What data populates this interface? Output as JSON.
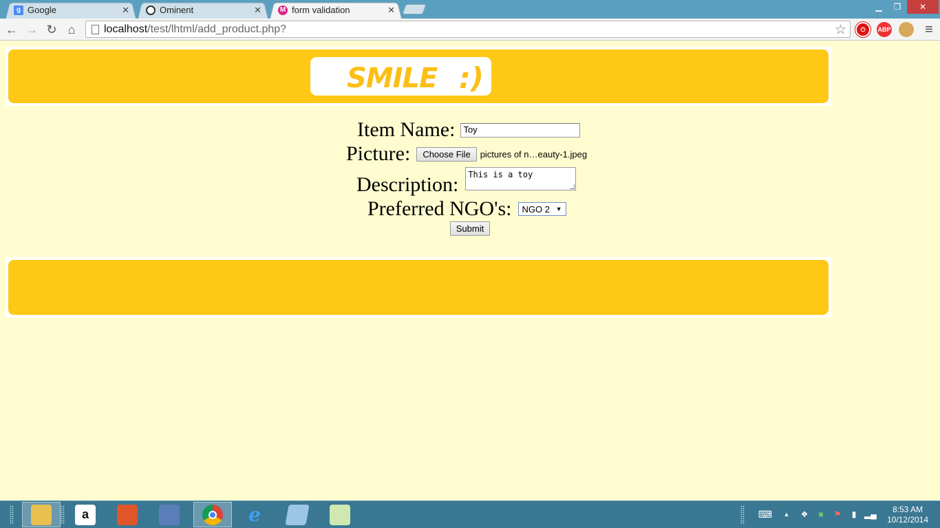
{
  "browser": {
    "tabs": [
      {
        "label": "Google",
        "icon": "google-favicon",
        "active": false
      },
      {
        "label": "Ominent",
        "icon": "ominent-favicon",
        "active": false
      },
      {
        "label": "form validation",
        "icon": "form-favicon",
        "active": true
      }
    ],
    "url_host": "localhost",
    "url_path": "/test/lhtml/add_product.php?",
    "extensions": [
      "stop-extension-icon",
      "adblock-plus-icon",
      "cookie-extension-icon"
    ],
    "extension_labels": {
      "adblock": "ABP"
    }
  },
  "page": {
    "logo": {
      "text": "SMILE",
      "smiley": ":)"
    },
    "form": {
      "item_name_label": "Item Name:",
      "item_name_value": "Toy",
      "picture_label": "Picture:",
      "choose_file_label": "Choose File",
      "file_name": "pictures of n…eauty-1.jpeg",
      "description_label": "Description:",
      "description_value": "This is a toy",
      "ngo_label": "Preferred NGO's:",
      "ngo_selected": "NGO 2",
      "submit_label": "Submit"
    }
  },
  "taskbar": {
    "apps": [
      "file-explorer-icon",
      "amazon-icon",
      "office-icon",
      "media-icon",
      "chrome-icon",
      "internet-explorer-icon",
      "notes-icon",
      "notepad-icon"
    ],
    "clock_time": "8:53 AM",
    "clock_date": "10/12/2014"
  },
  "colors": {
    "page_bg": "#fffdd0",
    "banner": "#ffc814",
    "logo_text": "#fcbf17",
    "tabstrip": "#5b9fc0",
    "taskbar": "#3a7793"
  }
}
